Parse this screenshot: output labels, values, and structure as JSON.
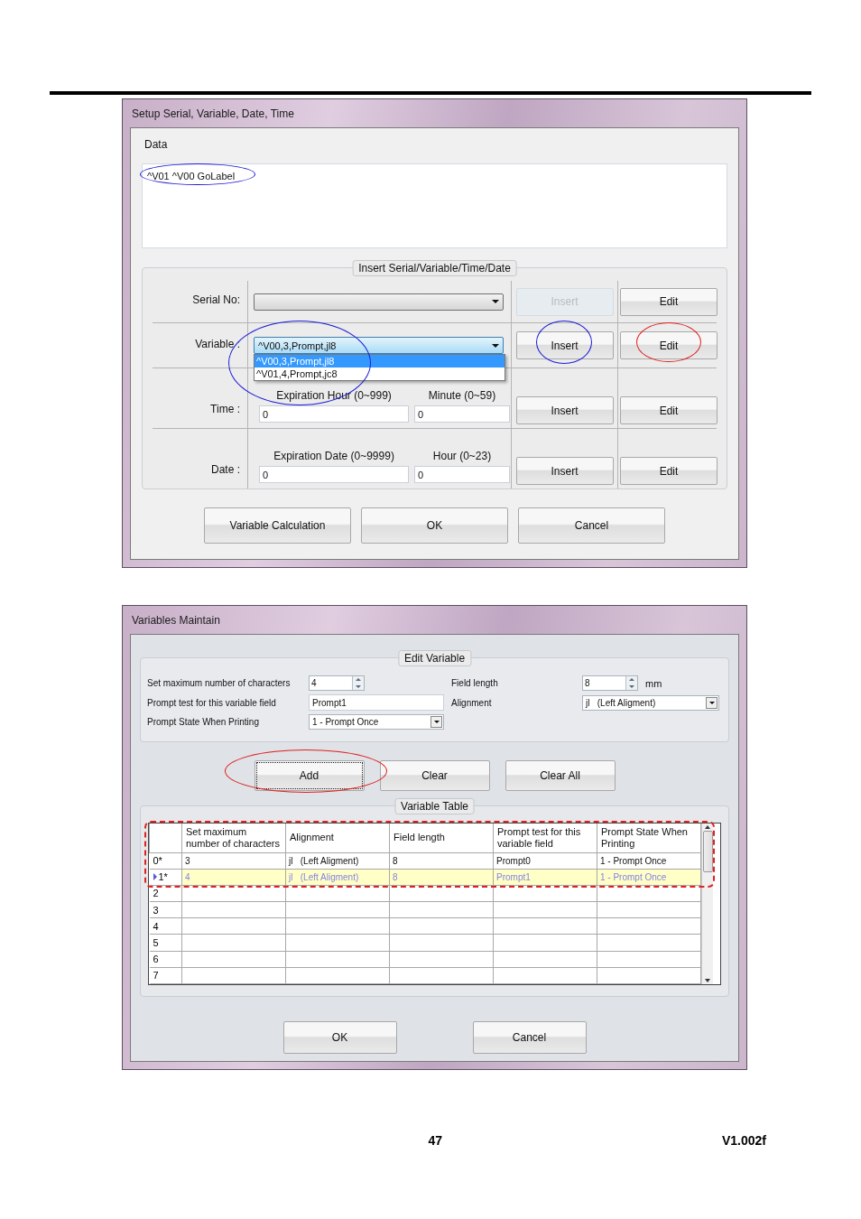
{
  "setup_dialog": {
    "title": "Setup Serial, Variable, Date, Time",
    "data_label": "Data",
    "data_value": "^V01 ^V00 GoLabel",
    "data_circle": {
      "color": "#1c1cd8"
    },
    "group_title": "Insert Serial/Variable/Time/Date",
    "rows": [
      {
        "kind": "combo",
        "label": "Serial No:",
        "combo": {
          "open": false
        },
        "insert": {
          "label": "Insert",
          "disabled": true
        },
        "edit": {
          "label": "Edit",
          "disabled": false
        }
      },
      {
        "kind": "combo",
        "label": "Variable :",
        "circle": {
          "color": "#1c1cd8"
        },
        "combo": {
          "value": "^V00,3,Prompt,jl8",
          "open": true,
          "options": [
            {
              "text": "^V00,3,Prompt,jl8",
              "selected": true
            },
            {
              "text": "^V01,4,Prompt,jc8",
              "selected": false
            }
          ]
        },
        "insert": {
          "label": "Insert",
          "disabled": false,
          "circle": {
            "color": "#1c1cd8"
          }
        },
        "edit": {
          "label": "Edit",
          "disabled": false,
          "circle": {
            "color": "#e02020"
          }
        }
      },
      {
        "kind": "inputs",
        "label": "Time :",
        "inputs": [
          {
            "caption": "Expiration Hour (0~999)",
            "value": "0"
          },
          {
            "caption": "Minute (0~59)",
            "value": "0"
          }
        ],
        "insert": {
          "label": "Insert",
          "disabled": false
        },
        "edit": {
          "label": "Edit",
          "disabled": false
        }
      },
      {
        "kind": "inputs",
        "label": "Date :",
        "inputs": [
          {
            "caption": "Expiration Date (0~9999)",
            "value": "0"
          },
          {
            "caption": "Hour (0~23)",
            "value": "0"
          }
        ],
        "insert": {
          "label": "Insert",
          "disabled": false
        },
        "edit": {
          "label": "Edit",
          "disabled": false
        }
      }
    ],
    "buttons": [
      "Variable Calculation",
      "OK",
      "Cancel"
    ]
  },
  "variables_dialog": {
    "title": "Variables Maintain",
    "group_title": "Edit Variable",
    "fields": [
      {
        "label": "Set maximum number of characters",
        "kind": "spin",
        "value": "4"
      },
      {
        "label": "Field length",
        "kind": "spin",
        "value": "8",
        "unit": "mm"
      },
      {
        "label": "Prompt test for this variable field",
        "kind": "text",
        "value": "Prompt1"
      },
      {
        "label": "Alignment",
        "kind": "combo",
        "value": "jl   (Left Aligment)"
      },
      {
        "label": "Prompt State When Printing",
        "kind": "combo",
        "value": "1 - Prompt Once"
      }
    ],
    "actions": [
      {
        "label": "Add",
        "focused": true,
        "circle": {
          "color": "#e02020"
        }
      },
      {
        "label": "Clear",
        "focused": false
      },
      {
        "label": "Clear All",
        "focused": false
      }
    ],
    "table": {
      "title": "Variable Table",
      "outline": {
        "color": "#e02020"
      },
      "columns": [
        "Set maximum number of characters",
        "Alignment",
        "Field length",
        "Prompt test for this variable field",
        "Prompt State When Printing"
      ],
      "rows": [
        {
          "header": "0*",
          "selected": false,
          "cells": [
            "3",
            "jl   (Left Aligment)",
            "8",
            "Prompt0",
            "1 - Prompt Once"
          ]
        },
        {
          "header": "1*",
          "selected": true,
          "cells": [
            "4",
            "jl   (Left Aligment)",
            "8",
            "Prompt1",
            "1 - Prompt Once"
          ]
        },
        {
          "header": "2",
          "selected": false
        },
        {
          "header": "3",
          "selected": false
        },
        {
          "header": "4",
          "selected": false
        },
        {
          "header": "5",
          "selected": false
        },
        {
          "header": "6",
          "selected": false
        },
        {
          "header": "7",
          "selected": false
        }
      ]
    },
    "buttons": [
      "OK",
      "Cancel"
    ]
  },
  "footer": {
    "page": "47",
    "version": "V1.002f"
  }
}
